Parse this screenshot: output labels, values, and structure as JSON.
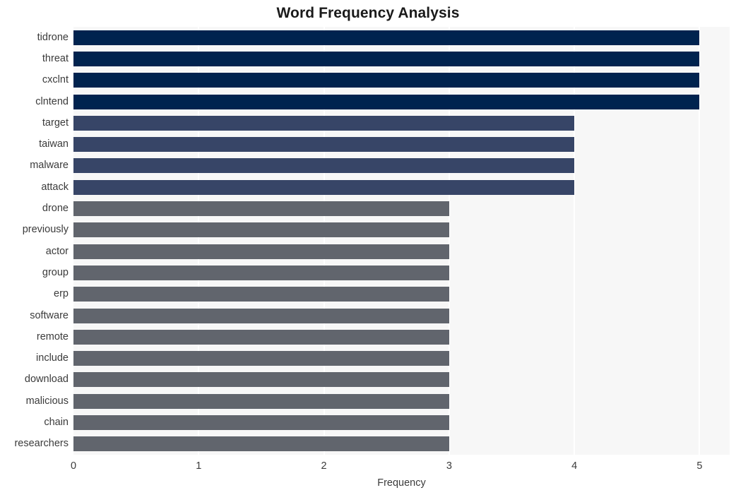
{
  "chart_data": {
    "type": "bar",
    "orientation": "horizontal",
    "title": "Word Frequency Analysis",
    "xlabel": "Frequency",
    "ylabel": "",
    "categories": [
      "tidrone",
      "threat",
      "cxclnt",
      "clntend",
      "target",
      "taiwan",
      "malware",
      "attack",
      "drone",
      "previously",
      "actor",
      "group",
      "erp",
      "software",
      "remote",
      "include",
      "download",
      "malicious",
      "chain",
      "researchers"
    ],
    "values": [
      5,
      5,
      5,
      5,
      4,
      4,
      4,
      4,
      3,
      3,
      3,
      3,
      3,
      3,
      3,
      3,
      3,
      3,
      3,
      3
    ],
    "bar_colors": [
      "#00234f",
      "#00234f",
      "#00234f",
      "#00234f",
      "#374567",
      "#374567",
      "#374567",
      "#374567",
      "#61656d",
      "#61656d",
      "#61656d",
      "#61656d",
      "#61656d",
      "#61656d",
      "#61656d",
      "#61656d",
      "#61656d",
      "#61656d",
      "#61656d",
      "#61656d"
    ],
    "xlim": [
      0,
      5.24
    ],
    "xticks": [
      0,
      1,
      2,
      3,
      4,
      5
    ],
    "xtick_labels": [
      "0",
      "1",
      "2",
      "3",
      "4",
      "5"
    ],
    "grid": true,
    "grid_axis": "x",
    "grid_color": "#ffffff",
    "plot_background": "#f7f7f7",
    "figure_background": "#ffffff",
    "legend": null
  }
}
